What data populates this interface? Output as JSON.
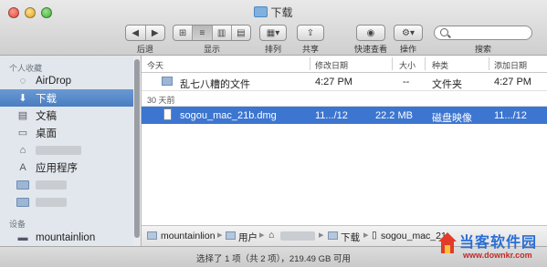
{
  "window": {
    "title": "下载"
  },
  "toolbar": {
    "back_label": "后退",
    "view_label": "显示",
    "arrange_label": "排列",
    "share_label": "共享",
    "quicklook_label": "快速查看",
    "action_label": "操作",
    "search_label": "搜索",
    "search_placeholder": ""
  },
  "sidebar": {
    "favorites_header": "个人收藏",
    "items": [
      {
        "label": "AirDrop",
        "icon": "airdrop-icon"
      },
      {
        "label": "下载",
        "icon": "download-icon",
        "selected": true
      },
      {
        "label": "文稿",
        "icon": "documents-icon"
      },
      {
        "label": "桌面",
        "icon": "desktop-icon"
      },
      {
        "label": "",
        "icon": "home-icon"
      },
      {
        "label": "应用程序",
        "icon": "applications-icon"
      },
      {
        "label": "",
        "icon": "folder-icon"
      },
      {
        "label": "",
        "icon": "folder-icon"
      }
    ],
    "devices_header": "设备",
    "devices": [
      {
        "label": "mountainlion",
        "icon": "disk-icon"
      }
    ]
  },
  "columns": {
    "name": "今天",
    "modified": "修改日期",
    "size": "大小",
    "kind": "种类",
    "added": "添加日期"
  },
  "groups": [
    {
      "label": "今天",
      "rows": [
        {
          "name": "乱七八糟的文件",
          "modified": "4:27 PM",
          "size": "--",
          "kind": "文件夹",
          "added": "4:27 PM",
          "icon": "folder-icon"
        }
      ]
    },
    {
      "label": "30 天前",
      "rows": [
        {
          "name": "sogou_mac_21b.dmg",
          "modified": "11.../12",
          "size": "22.2 MB",
          "kind": "磁盘映像",
          "added": "11.../12",
          "icon": "dmg-file-icon",
          "selected": true
        }
      ]
    }
  ],
  "pathbar": [
    "mountainlion",
    "用户",
    "",
    "下载",
    "sogou_mac_21"
  ],
  "status": "选择了 1 项（共 2 项），219.49 GB 可用",
  "watermark": {
    "title": "当客软件园",
    "url": "www.downkr.com"
  },
  "colors": {
    "selection": "#3d76d0",
    "sidebar_bg": "#e2e7ed",
    "watermark_blue": "#2a6fd6",
    "watermark_red": "#c02a2a"
  }
}
